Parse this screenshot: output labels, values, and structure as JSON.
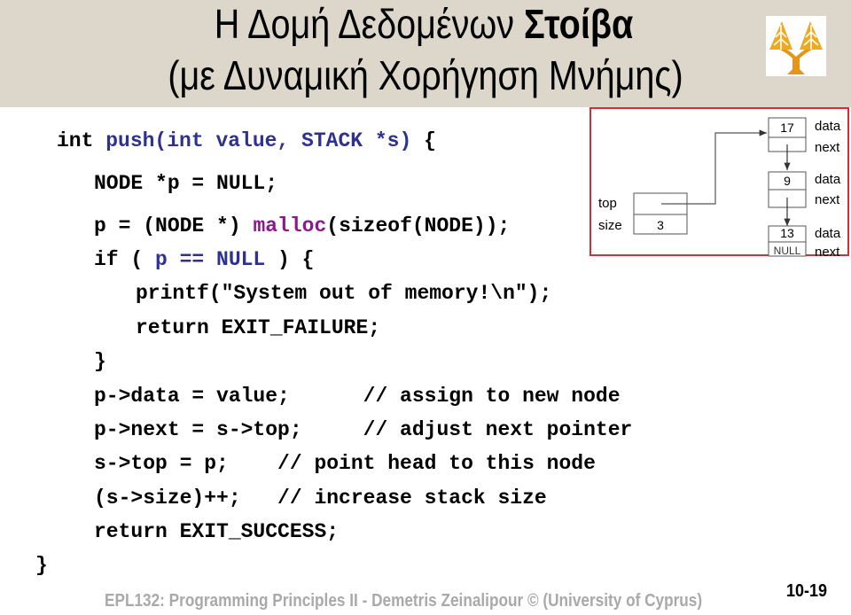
{
  "slide": {
    "title_line1_regular": "Η Δομή Δεδομένων ",
    "title_line1_bold": "Στοίβα",
    "title_line2": "(με Δυναμική Χορήγηση Μνήμης)",
    "logo_icon": "university-of-cyprus-logo-icon",
    "colors": {
      "header_bg": "#ddd7cb",
      "code_blue": "#2e3192",
      "code_purple": "#8b1a8b",
      "diagram_border": "#d32f3b",
      "footer_text": "#a9a9a9"
    }
  },
  "code": {
    "line1": {
      "kw": "int ",
      "sig": "push(int value, STACK *s)",
      "tail": " {"
    },
    "line2": "NODE *p = NULL;",
    "line3": {
      "pre": "p = (NODE *) ",
      "fn": "malloc",
      "post": "(sizeof(NODE));"
    },
    "line4": {
      "pre": "if ( ",
      "var": "p == NULL",
      "post": " ) {"
    },
    "line5": "printf(\"System out of memory!\\n\");",
    "line6": "return EXIT_FAILURE;",
    "line7": "}",
    "line8": "p->data = value;      // assign to new node",
    "line9": "p->next = s->top;     // adjust next pointer",
    "line10": "s->top = p;    // point head to this node",
    "line11": "(s->size)++;   // increase stack size",
    "line12": "return EXIT_SUCCESS;",
    "line13": "}"
  },
  "diagram": {
    "stack_labels": {
      "top": "top",
      "size": "size"
    },
    "stack_size_value": "3",
    "nodes": [
      {
        "data": "17",
        "next": ""
      },
      {
        "data": "9",
        "next": ""
      },
      {
        "data": "13",
        "next": "NULL"
      }
    ],
    "field_labels": {
      "data": "data",
      "next": "next"
    }
  },
  "footer": {
    "text": "EPL132: Programming Principles II - Demetris Zeinalipour © (University of Cyprus)",
    "slide_number": "10-19"
  }
}
